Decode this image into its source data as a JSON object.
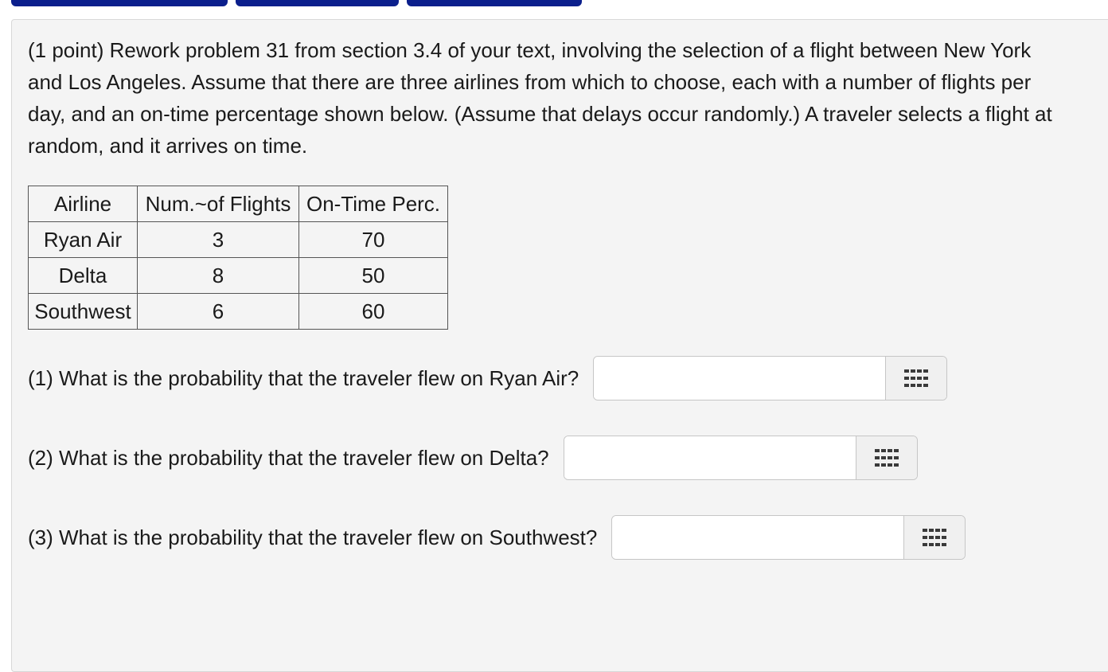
{
  "problem": {
    "text": "(1 point) Rework problem 31 from section 3.4 of your text, involving the selection of a flight between New York and Los Angeles. Assume that there are three airlines from which to choose, each with a number of flights per day, and an on-time percentage shown below. (Assume that delays occur randomly.) A traveler selects a flight at random, and it arrives on time."
  },
  "table": {
    "headers": [
      "Airline",
      "Num.~of Flights",
      "On-Time Perc."
    ],
    "rows": [
      [
        "Ryan Air",
        "3",
        "70"
      ],
      [
        "Delta",
        "8",
        "50"
      ],
      [
        "Southwest",
        "6",
        "60"
      ]
    ]
  },
  "questions": [
    {
      "label": "(1) What is the probability that the traveler flew on Ryan Air?",
      "value": ""
    },
    {
      "label": "(2) What is the probability that the traveler flew on Delta?",
      "value": ""
    },
    {
      "label": "(3) What is the probability that the traveler flew on Southwest?",
      "value": ""
    }
  ],
  "colors": {
    "tab_blue": "#0b1f8c",
    "panel_bg": "#f4f4f4"
  },
  "icons": {
    "answer_button": "grid-icon"
  }
}
